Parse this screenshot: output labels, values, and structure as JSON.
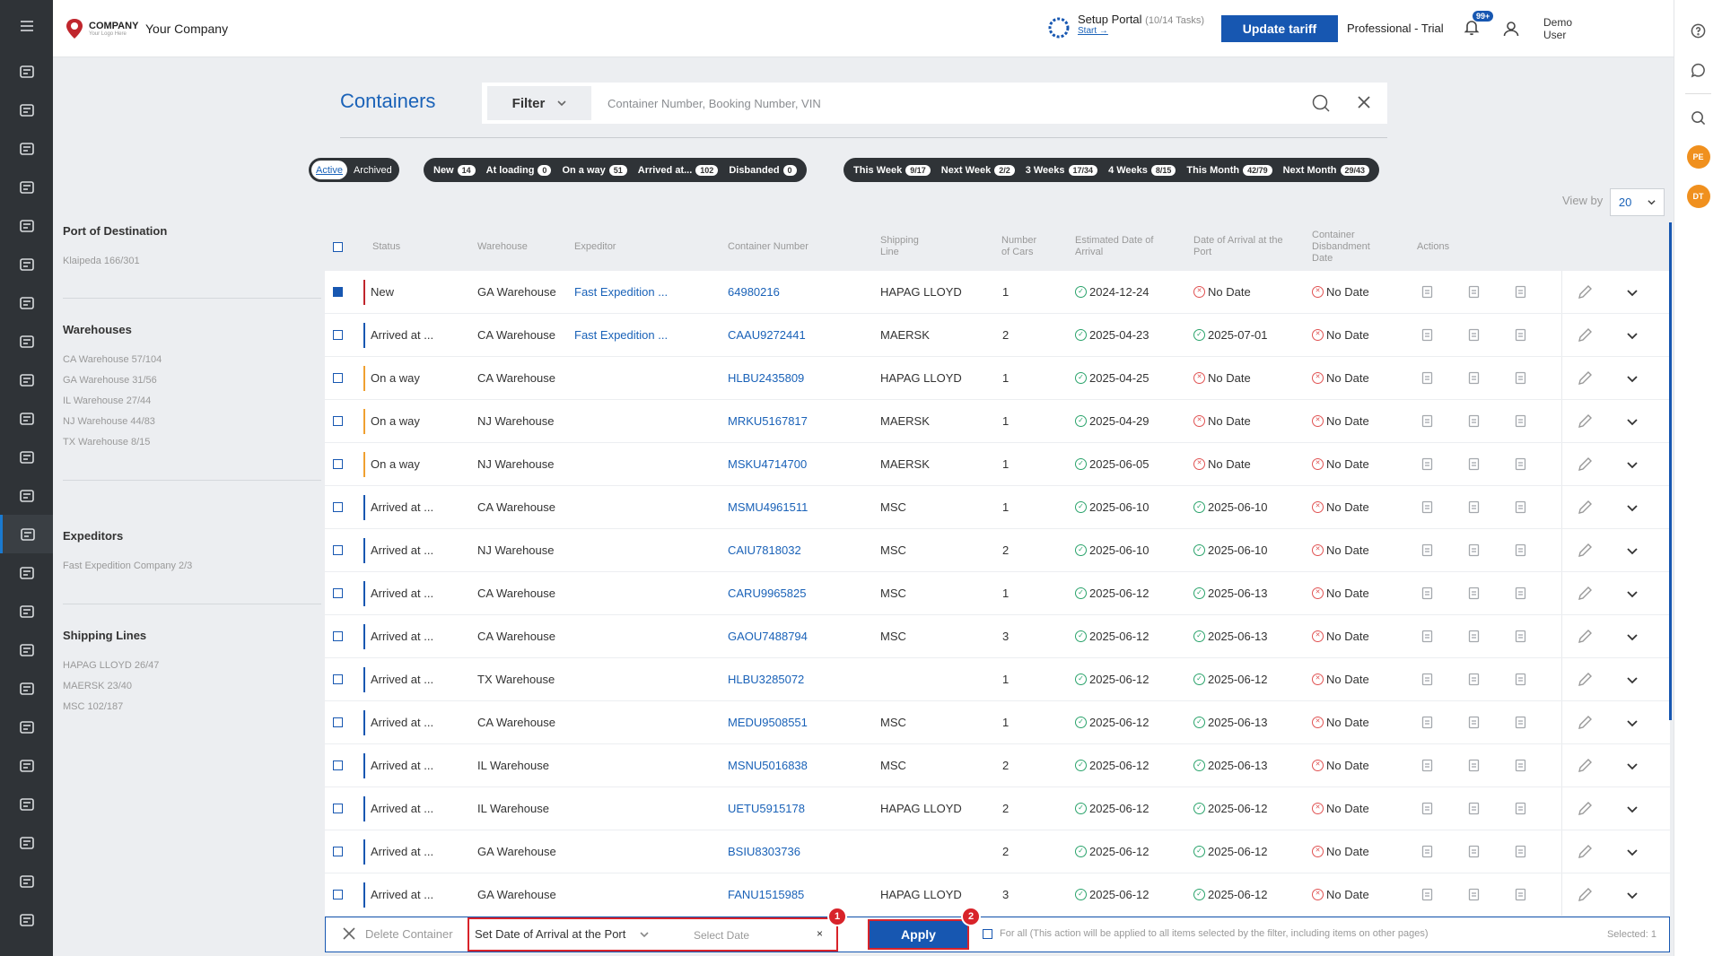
{
  "header": {
    "logo_title": "COMPANY",
    "logo_subtitle": "Your Logo Here",
    "company_name": "Your Company",
    "setup_title": "Setup Portal",
    "setup_count": "(10/14 Tasks)",
    "setup_link": "Start →",
    "update_button": "Update tariff",
    "plan": "Professional - Trial",
    "notif_badge": "99+",
    "user_name": "Demo User"
  },
  "page": {
    "title": "Containers",
    "filter_label": "Filter",
    "search_placeholder": "Container Number, Booking Number, VIN"
  },
  "tabs": {
    "active": "Active",
    "archived": "Archived"
  },
  "status_filters": [
    {
      "label": "New",
      "count": "14"
    },
    {
      "label": "At loading",
      "count": "0"
    },
    {
      "label": "On a way",
      "count": "51"
    },
    {
      "label": "Arrived at...",
      "count": "102"
    },
    {
      "label": "Disbanded",
      "count": "0"
    }
  ],
  "period_filters": [
    {
      "label": "This Week",
      "count": "9/17"
    },
    {
      "label": "Next Week",
      "count": "2/2"
    },
    {
      "label": "3 Weeks",
      "count": "17/34"
    },
    {
      "label": "4 Weeks",
      "count": "8/15"
    },
    {
      "label": "This Month",
      "count": "42/79"
    },
    {
      "label": "Next Month",
      "count": "29/43"
    }
  ],
  "view_by": {
    "label": "View by",
    "value": "20"
  },
  "sidebar_filters": [
    {
      "title": "Port of Destination",
      "items": [
        "Klaipeda 166/301"
      ]
    },
    {
      "title": "Warehouses",
      "items": [
        "CA Warehouse 57/104",
        "GA Warehouse 31/56",
        "IL Warehouse 27/44",
        "NJ Warehouse 44/83",
        "TX Warehouse 8/15"
      ]
    },
    {
      "title": "Expeditors",
      "items": [
        "Fast Expedition Company 2/3"
      ]
    },
    {
      "title": "Shipping Lines",
      "items": [
        "HAPAG LLOYD 26/47",
        "MAERSK 23/40",
        "MSC 102/187"
      ]
    }
  ],
  "columns": {
    "status": "Status",
    "warehouse": "Warehouse",
    "expeditor": "Expeditor",
    "container": "Container Number",
    "line": "Shipping Line",
    "cars": "Number of Cars",
    "eta": "Estimated Date of Arrival",
    "arrival": "Date of Arrival at the Port",
    "disband": "Container Disbandment Date",
    "actions": "Actions"
  },
  "rows": [
    {
      "status": "New",
      "color": "#c0262d",
      "warehouse": "GA Warehouse",
      "expeditor": "Fast Expedition ...",
      "container": "64980216",
      "line": "HAPAG LLOYD",
      "cars": "1",
      "eta": "2024-12-24",
      "arrival": "No Date",
      "disband": "No Date",
      "checked": true
    },
    {
      "status": "Arrived at ...",
      "color": "#1757b1",
      "warehouse": "CA Warehouse",
      "expeditor": "Fast Expedition ...",
      "container": "CAAU9272441",
      "line": "MAERSK",
      "cars": "2",
      "eta": "2025-04-23",
      "arrival": "2025-07-01",
      "disband": "No Date",
      "checked": false
    },
    {
      "status": "On a way",
      "color": "#f0a030",
      "warehouse": "CA Warehouse",
      "expeditor": "",
      "container": "HLBU2435809",
      "line": "HAPAG LLOYD",
      "cars": "1",
      "eta": "2025-04-25",
      "arrival": "No Date",
      "disband": "No Date",
      "checked": false
    },
    {
      "status": "On a way",
      "color": "#f0a030",
      "warehouse": "NJ Warehouse",
      "expeditor": "",
      "container": "MRKU5167817",
      "line": "MAERSK",
      "cars": "1",
      "eta": "2025-04-29",
      "arrival": "No Date",
      "disband": "No Date",
      "checked": false
    },
    {
      "status": "On a way",
      "color": "#f0a030",
      "warehouse": "NJ Warehouse",
      "expeditor": "",
      "container": "MSKU4714700",
      "line": "MAERSK",
      "cars": "1",
      "eta": "2025-06-05",
      "arrival": "No Date",
      "disband": "No Date",
      "checked": false
    },
    {
      "status": "Arrived at ...",
      "color": "#1757b1",
      "warehouse": "CA Warehouse",
      "expeditor": "",
      "container": "MSMU4961511",
      "line": "MSC",
      "cars": "1",
      "eta": "2025-06-10",
      "arrival": "2025-06-10",
      "disband": "No Date",
      "checked": false
    },
    {
      "status": "Arrived at ...",
      "color": "#1757b1",
      "warehouse": "NJ Warehouse",
      "expeditor": "",
      "container": "CAIU7818032",
      "line": "MSC",
      "cars": "2",
      "eta": "2025-06-10",
      "arrival": "2025-06-10",
      "disband": "No Date",
      "checked": false
    },
    {
      "status": "Arrived at ...",
      "color": "#1757b1",
      "warehouse": "CA Warehouse",
      "expeditor": "",
      "container": "CARU9965825",
      "line": "MSC",
      "cars": "1",
      "eta": "2025-06-12",
      "arrival": "2025-06-13",
      "disband": "No Date",
      "checked": false
    },
    {
      "status": "Arrived at ...",
      "color": "#1757b1",
      "warehouse": "CA Warehouse",
      "expeditor": "",
      "container": "GAOU7488794",
      "line": "MSC",
      "cars": "3",
      "eta": "2025-06-12",
      "arrival": "2025-06-13",
      "disband": "No Date",
      "checked": false
    },
    {
      "status": "Arrived at ...",
      "color": "#1757b1",
      "warehouse": "TX Warehouse",
      "expeditor": "",
      "container": "HLBU3285072",
      "line": "",
      "cars": "1",
      "eta": "2025-06-12",
      "arrival": "2025-06-12",
      "disband": "No Date",
      "checked": false
    },
    {
      "status": "Arrived at ...",
      "color": "#1757b1",
      "warehouse": "CA Warehouse",
      "expeditor": "",
      "container": "MEDU9508551",
      "line": "MSC",
      "cars": "1",
      "eta": "2025-06-12",
      "arrival": "2025-06-13",
      "disband": "No Date",
      "checked": false
    },
    {
      "status": "Arrived at ...",
      "color": "#1757b1",
      "warehouse": "IL Warehouse",
      "expeditor": "",
      "container": "MSNU5016838",
      "line": "MSC",
      "cars": "2",
      "eta": "2025-06-12",
      "arrival": "2025-06-13",
      "disband": "No Date",
      "checked": false
    },
    {
      "status": "Arrived at ...",
      "color": "#1757b1",
      "warehouse": "IL Warehouse",
      "expeditor": "",
      "container": "UETU5915178",
      "line": "HAPAG LLOYD",
      "cars": "2",
      "eta": "2025-06-12",
      "arrival": "2025-06-12",
      "disband": "No Date",
      "checked": false
    },
    {
      "status": "Arrived at ...",
      "color": "#1757b1",
      "warehouse": "GA Warehouse",
      "expeditor": "",
      "container": "BSIU8303736",
      "line": "",
      "cars": "2",
      "eta": "2025-06-12",
      "arrival": "2025-06-12",
      "disband": "No Date",
      "checked": false
    },
    {
      "status": "Arrived at ...",
      "color": "#1757b1",
      "warehouse": "GA Warehouse",
      "expeditor": "",
      "container": "FANU1515985",
      "line": "HAPAG LLOYD",
      "cars": "3",
      "eta": "2025-06-12",
      "arrival": "2025-06-12",
      "disband": "No Date",
      "checked": false
    }
  ],
  "action_bar": {
    "delete_label": "Delete Container",
    "bulk_action": "Set Date of Arrival at the Port",
    "date_placeholder": "Select Date",
    "date_clear": "×",
    "marker_1": "1",
    "marker_2": "2",
    "apply": "Apply",
    "for_all": "For all (This action will be applied to all items selected by the filter, including items on other pages)",
    "selected": "Selected: 1"
  }
}
